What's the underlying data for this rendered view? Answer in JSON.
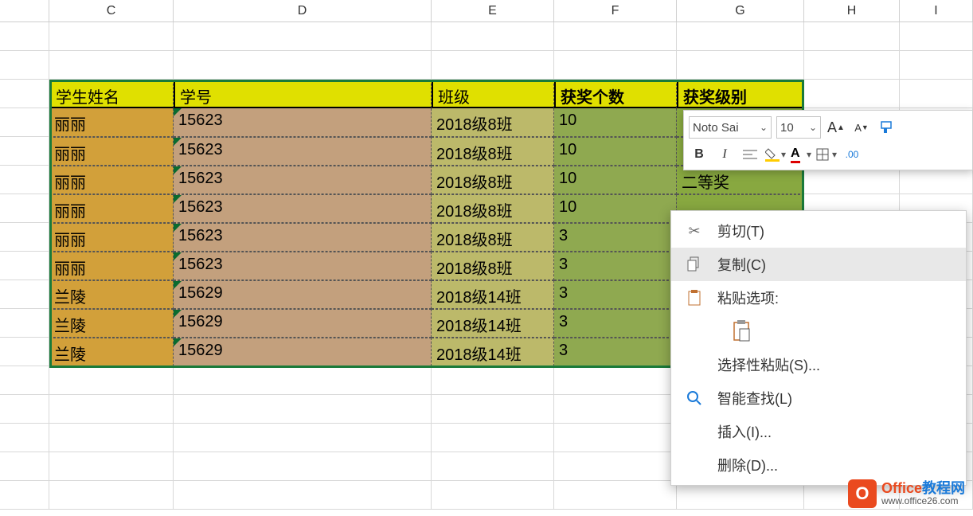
{
  "columns": {
    "B": "",
    "C": "C",
    "D": "D",
    "E": "E",
    "F": "F",
    "G": "G",
    "H": "H",
    "I": "I"
  },
  "table": {
    "headers": [
      "学生姓名",
      "学号",
      "班级",
      "获奖个数",
      "获奖级别"
    ],
    "rows": [
      [
        "丽丽",
        "15623",
        "2018级8班",
        "10",
        ""
      ],
      [
        "丽丽",
        "15623",
        "2018级8班",
        "10",
        ""
      ],
      [
        "丽丽",
        "15623",
        "2018级8班",
        "10",
        "二等奖"
      ],
      [
        "丽丽",
        "15623",
        "2018级8班",
        "10",
        ""
      ],
      [
        "丽丽",
        "15623",
        "2018级8班",
        "3",
        ""
      ],
      [
        "丽丽",
        "15623",
        "2018级8班",
        "3",
        ""
      ],
      [
        "兰陵",
        "15629",
        "2018级14班",
        "3",
        ""
      ],
      [
        "兰陵",
        "15629",
        "2018级14班",
        "3",
        ""
      ],
      [
        "兰陵",
        "15629",
        "2018级14班",
        "3",
        ""
      ]
    ]
  },
  "mini_toolbar": {
    "font_name": "Noto Sai",
    "font_size": "10",
    "grow_font": "A",
    "shrink_font": "A",
    "bold": "B",
    "italic": "I"
  },
  "context_menu": {
    "cut": "剪切(T)",
    "copy": "复制(C)",
    "paste_options": "粘贴选项:",
    "paste_special": "选择性粘贴(S)...",
    "smart_lookup": "智能查找(L)",
    "insert": "插入(I)...",
    "delete": "删除(D)..."
  },
  "watermark": {
    "title_a": "Office",
    "title_b": "教程网",
    "url": "www.office26.com",
    "logo": "O"
  }
}
